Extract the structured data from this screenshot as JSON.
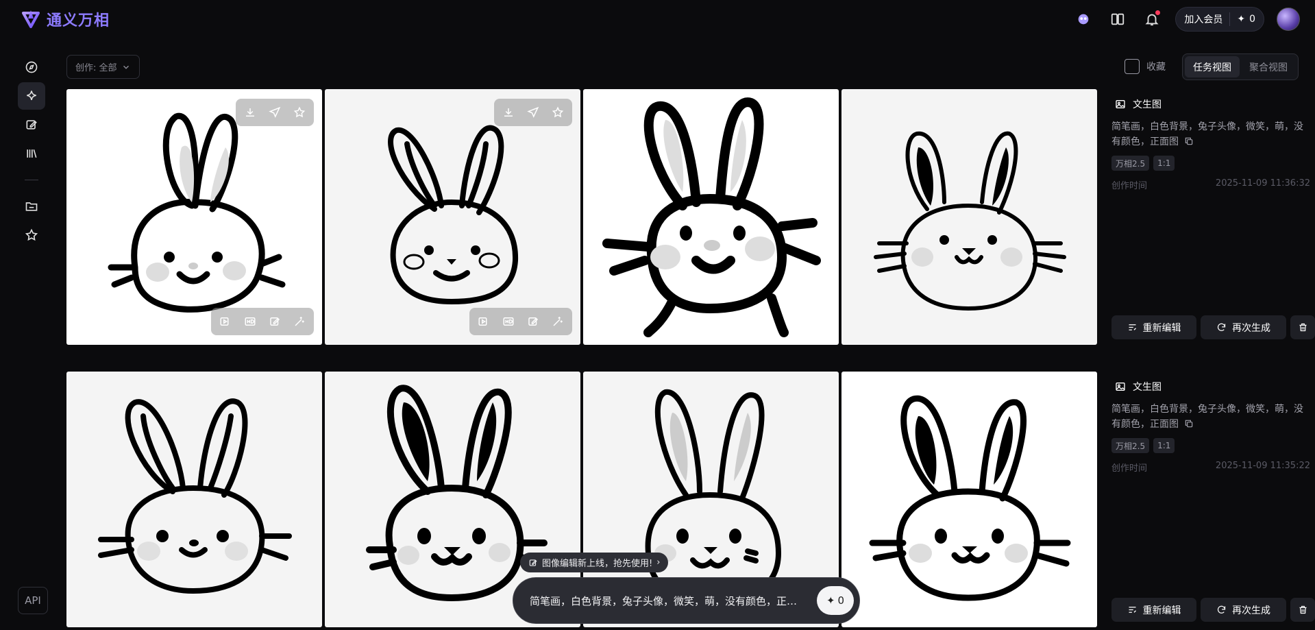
{
  "app": {
    "name": "通义万相"
  },
  "topbar": {
    "join_member": "加入会员",
    "credits": "0"
  },
  "filter": {
    "label": "创作: 全部"
  },
  "favorites": {
    "label": "收藏"
  },
  "views": {
    "task_view": "任务视图",
    "aggregate_view": "聚合视图"
  },
  "tasks": [
    {
      "type": "文生图",
      "prompt": "简笔画，白色背景，兔子头像，微笑，萌，没有颜色，正面图",
      "tags": [
        "万相2.5",
        "1:1"
      ],
      "time_label": "创作时间",
      "time": "2025-11-09 11:36:32",
      "reedit": "重新编辑",
      "regenerate": "再次生成"
    },
    {
      "type": "文生图",
      "prompt": "简笔画，白色背景，兔子头像，微笑，萌，没有颜色，正面图",
      "tags": [
        "万相2.5",
        "1:1"
      ],
      "time_label": "创作时间",
      "time": "2025-11-09 11:35:22",
      "reedit": "重新编辑",
      "regenerate": "再次生成"
    }
  ],
  "promo": {
    "text": "图像编辑新上线，抢先使用!"
  },
  "composer": {
    "prompt": "简笔画，白色背景，兔子头像，微笑，萌，没有颜色，正面图",
    "cost": "0"
  },
  "sidebar": {
    "api": "API"
  },
  "icons": {
    "logo": "wanxiang-logo",
    "compass": "compass-icon",
    "sparkle": "sparkle-icon",
    "edit": "edit-image-icon",
    "library": "library-icon",
    "folder": "folder-icon",
    "star": "star-icon"
  }
}
